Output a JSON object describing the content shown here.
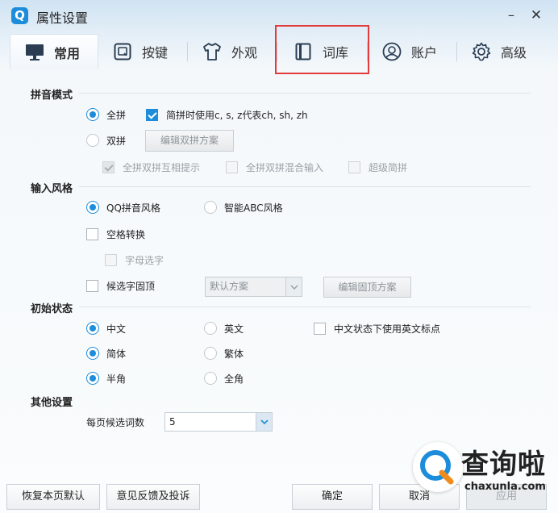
{
  "window": {
    "title": "属性设置",
    "logo_letter": "Q",
    "minimize": "–",
    "close": "✕"
  },
  "tabs": [
    {
      "label": "常用",
      "icon": "monitor-icon",
      "active": true
    },
    {
      "label": "按键",
      "icon": "key-icon"
    },
    {
      "label": "外观",
      "icon": "tshirt-icon"
    },
    {
      "label": "词库",
      "icon": "book-icon"
    },
    {
      "label": "账户",
      "icon": "user-circle-icon"
    },
    {
      "label": "高级",
      "icon": "gear-icon"
    }
  ],
  "pinyin_mode": {
    "title": "拼音模式",
    "quanpin": "全拼",
    "quanpin_simplify": "简拼时使用c, s, z代表ch, sh, zh",
    "shuangpin": "双拼",
    "edit_shuangpin_button": "编辑双拼方案",
    "mutual_hint": "全拼双拼互相提示",
    "mixed_input": "全拼双拼混合输入",
    "super_jianpin": "超级简拼"
  },
  "input_style": {
    "title": "输入风格",
    "qq_style": "QQ拼音风格",
    "abc_style": "智能ABC风格",
    "space_convert": "空格转换",
    "letter_select": "字母选字",
    "pin_top": "候选字固顶",
    "pin_scheme_value": "默认方案",
    "edit_pin_button": "编辑固顶方案"
  },
  "initial_state": {
    "title": "初始状态",
    "chinese": "中文",
    "english": "英文",
    "eng_punct": "中文状态下使用英文标点",
    "simplified": "简体",
    "traditional": "繁体",
    "half_width": "半角",
    "full_width": "全角"
  },
  "other": {
    "title": "其他设置",
    "per_page_label": "每页候选词数",
    "per_page_value": "5"
  },
  "footer": {
    "restore_default": "恢复本页默认",
    "feedback": "意见反馈及投诉",
    "ok": "确定",
    "cancel": "取消",
    "apply": "应用"
  },
  "watermark": {
    "text": "查询啦",
    "url": "chaxunla.com"
  },
  "colors": {
    "accent": "#1d8ddb",
    "highlight": "#e33b3b"
  }
}
